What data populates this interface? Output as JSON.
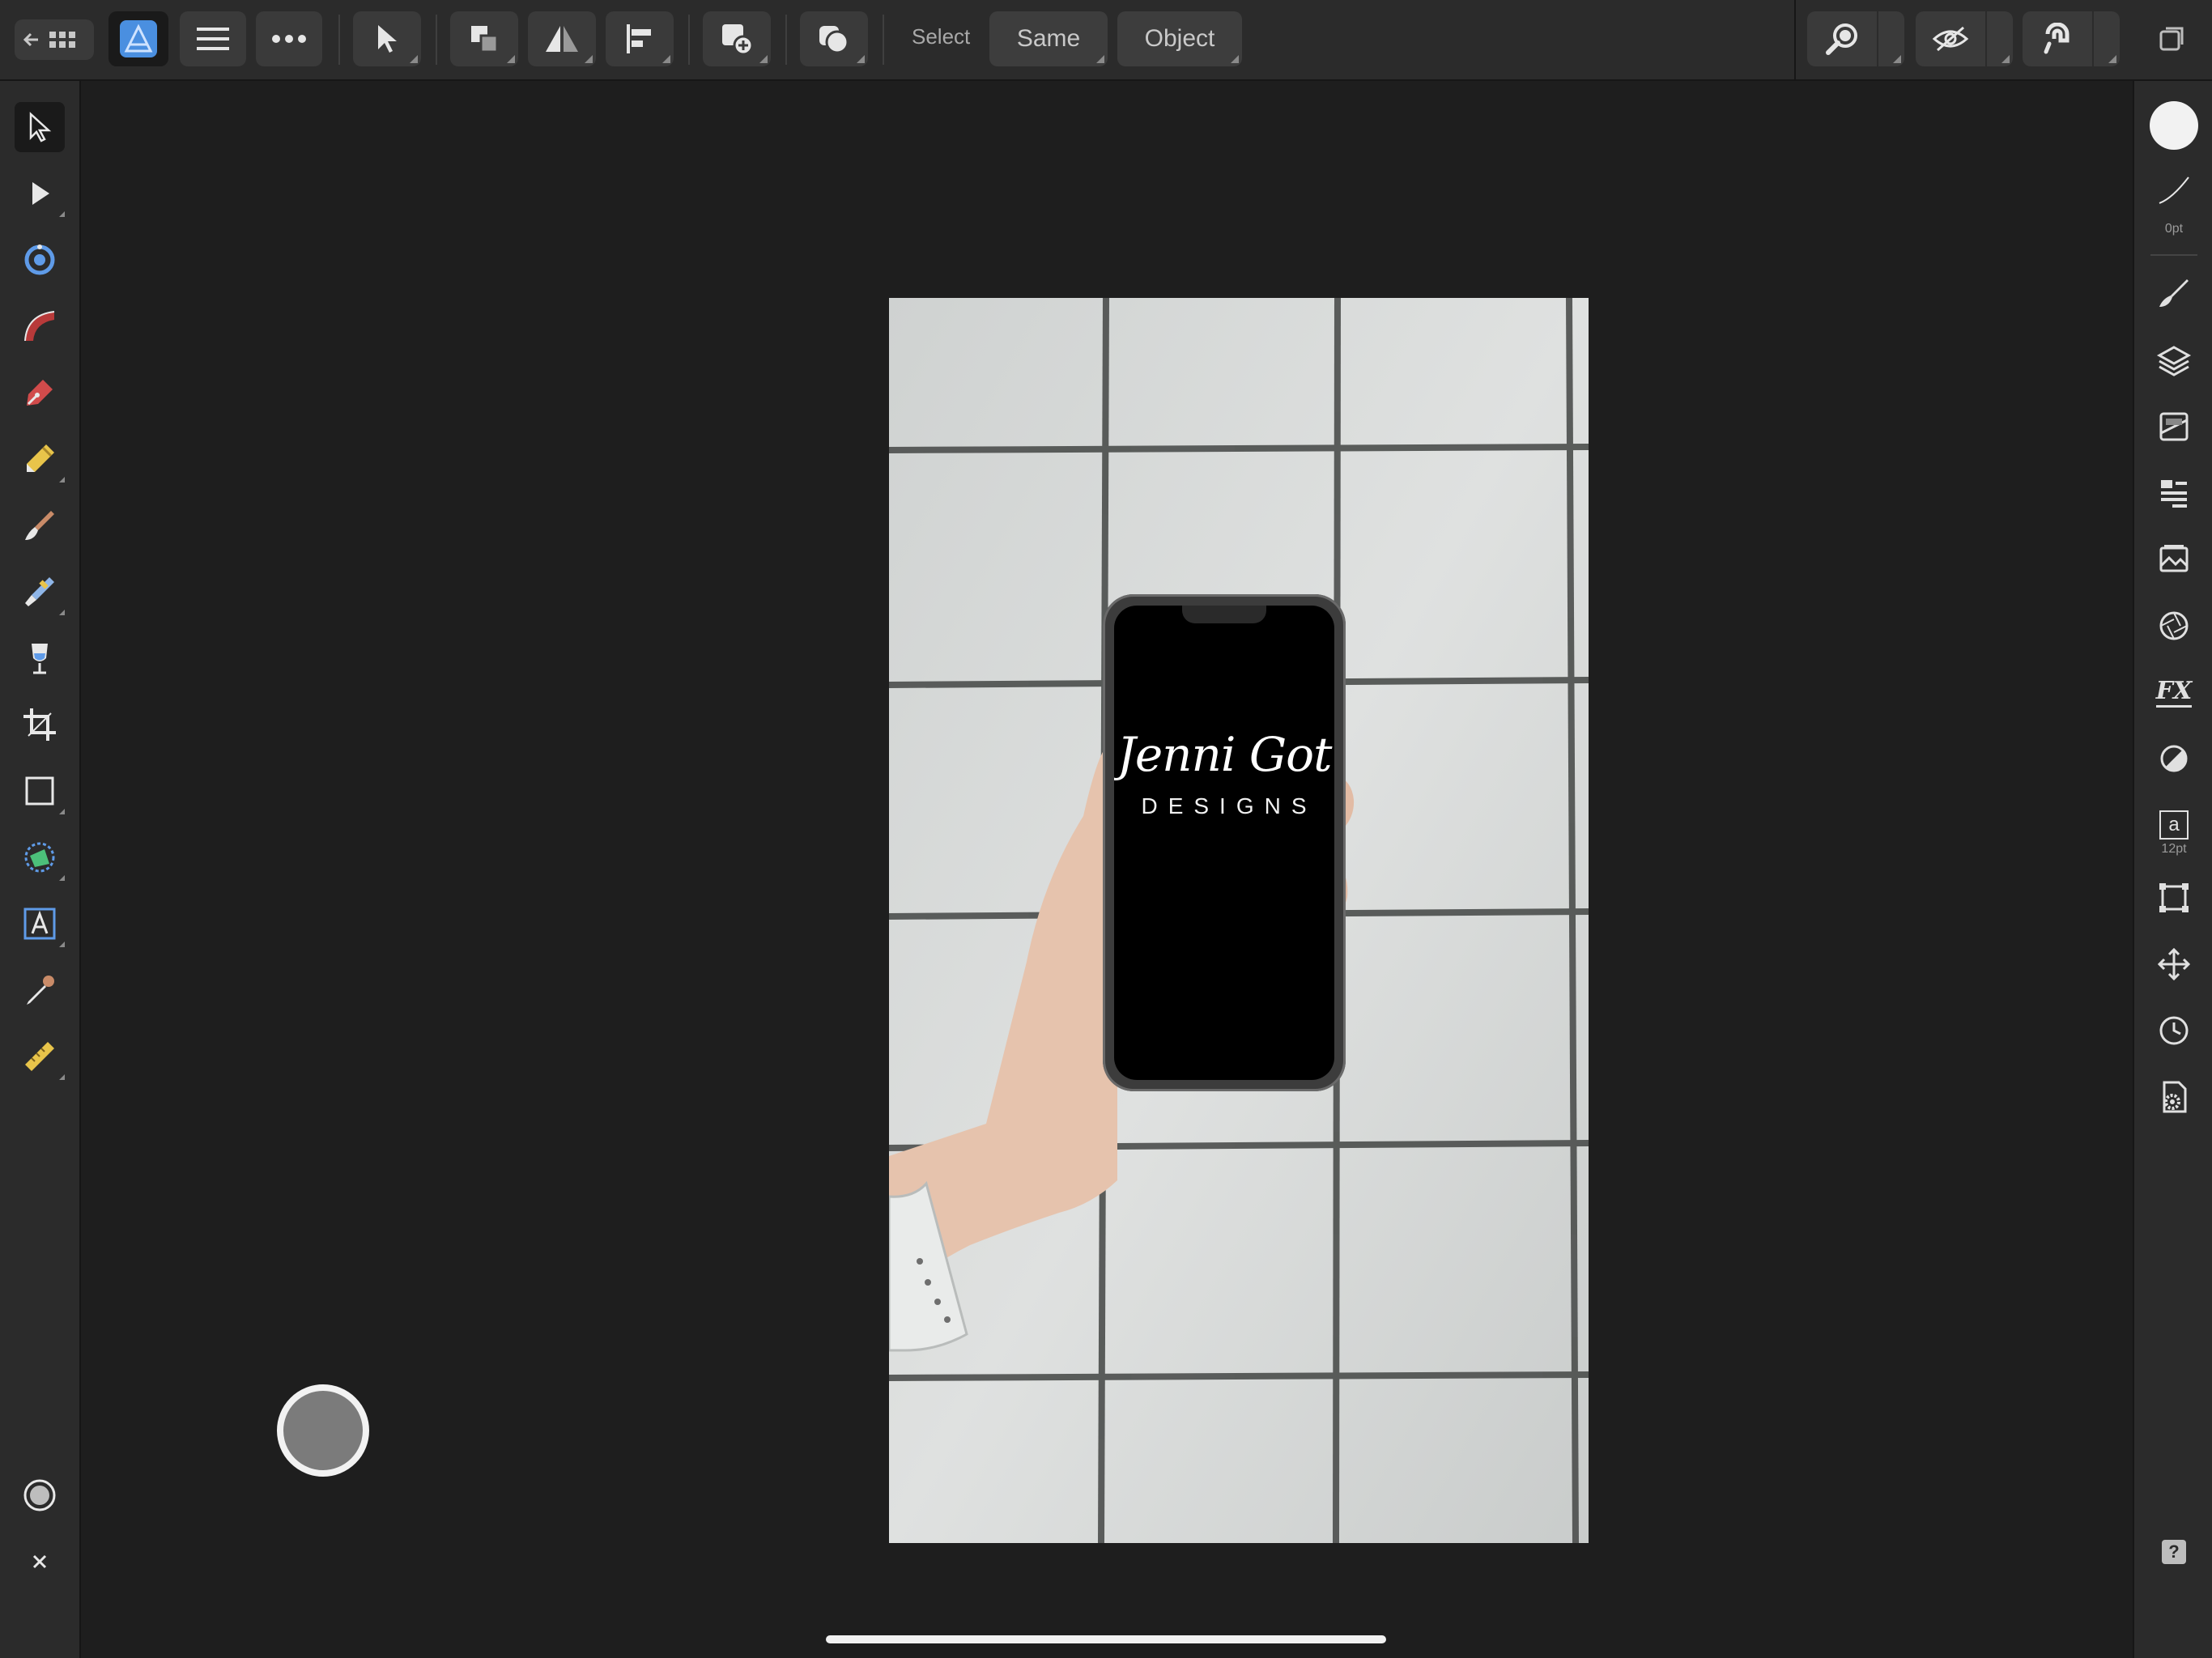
{
  "toolbar": {
    "back_icon": "back-arrow-grid-icon",
    "persona_icon": "affinity-designer-icon",
    "menu_icon": "hamburger-icon",
    "more_icon": "more-dots-icon",
    "select_label": "Select",
    "same_label": "Same",
    "object_label": "Object"
  },
  "left_tools": [
    "move-tool-icon",
    "node-tool-icon",
    "corner-tool-icon",
    "pencil-curve-tool-icon",
    "pen-tool-icon",
    "pencil-tool-icon",
    "brush-tool-icon",
    "vector-brush-tool-icon",
    "fill-tool-icon",
    "crop-tool-icon",
    "rectangle-tool-icon",
    "shape-tool-icon",
    "text-tool-icon",
    "color-picker-tool-icon",
    "measure-tool-icon"
  ],
  "right_panel": {
    "stroke_width": "0pt",
    "text_size": "12pt",
    "text_glyph": "a",
    "fx_label": "FX",
    "help_label": "?"
  },
  "document": {
    "logo_script": "Jenni Got",
    "logo_sub": "DESIGNS"
  },
  "colors": {
    "background": "#1e1e1e",
    "panel": "#2b2b2b",
    "button": "#3a3a3a",
    "accent_blue": "#4a8fe0"
  }
}
